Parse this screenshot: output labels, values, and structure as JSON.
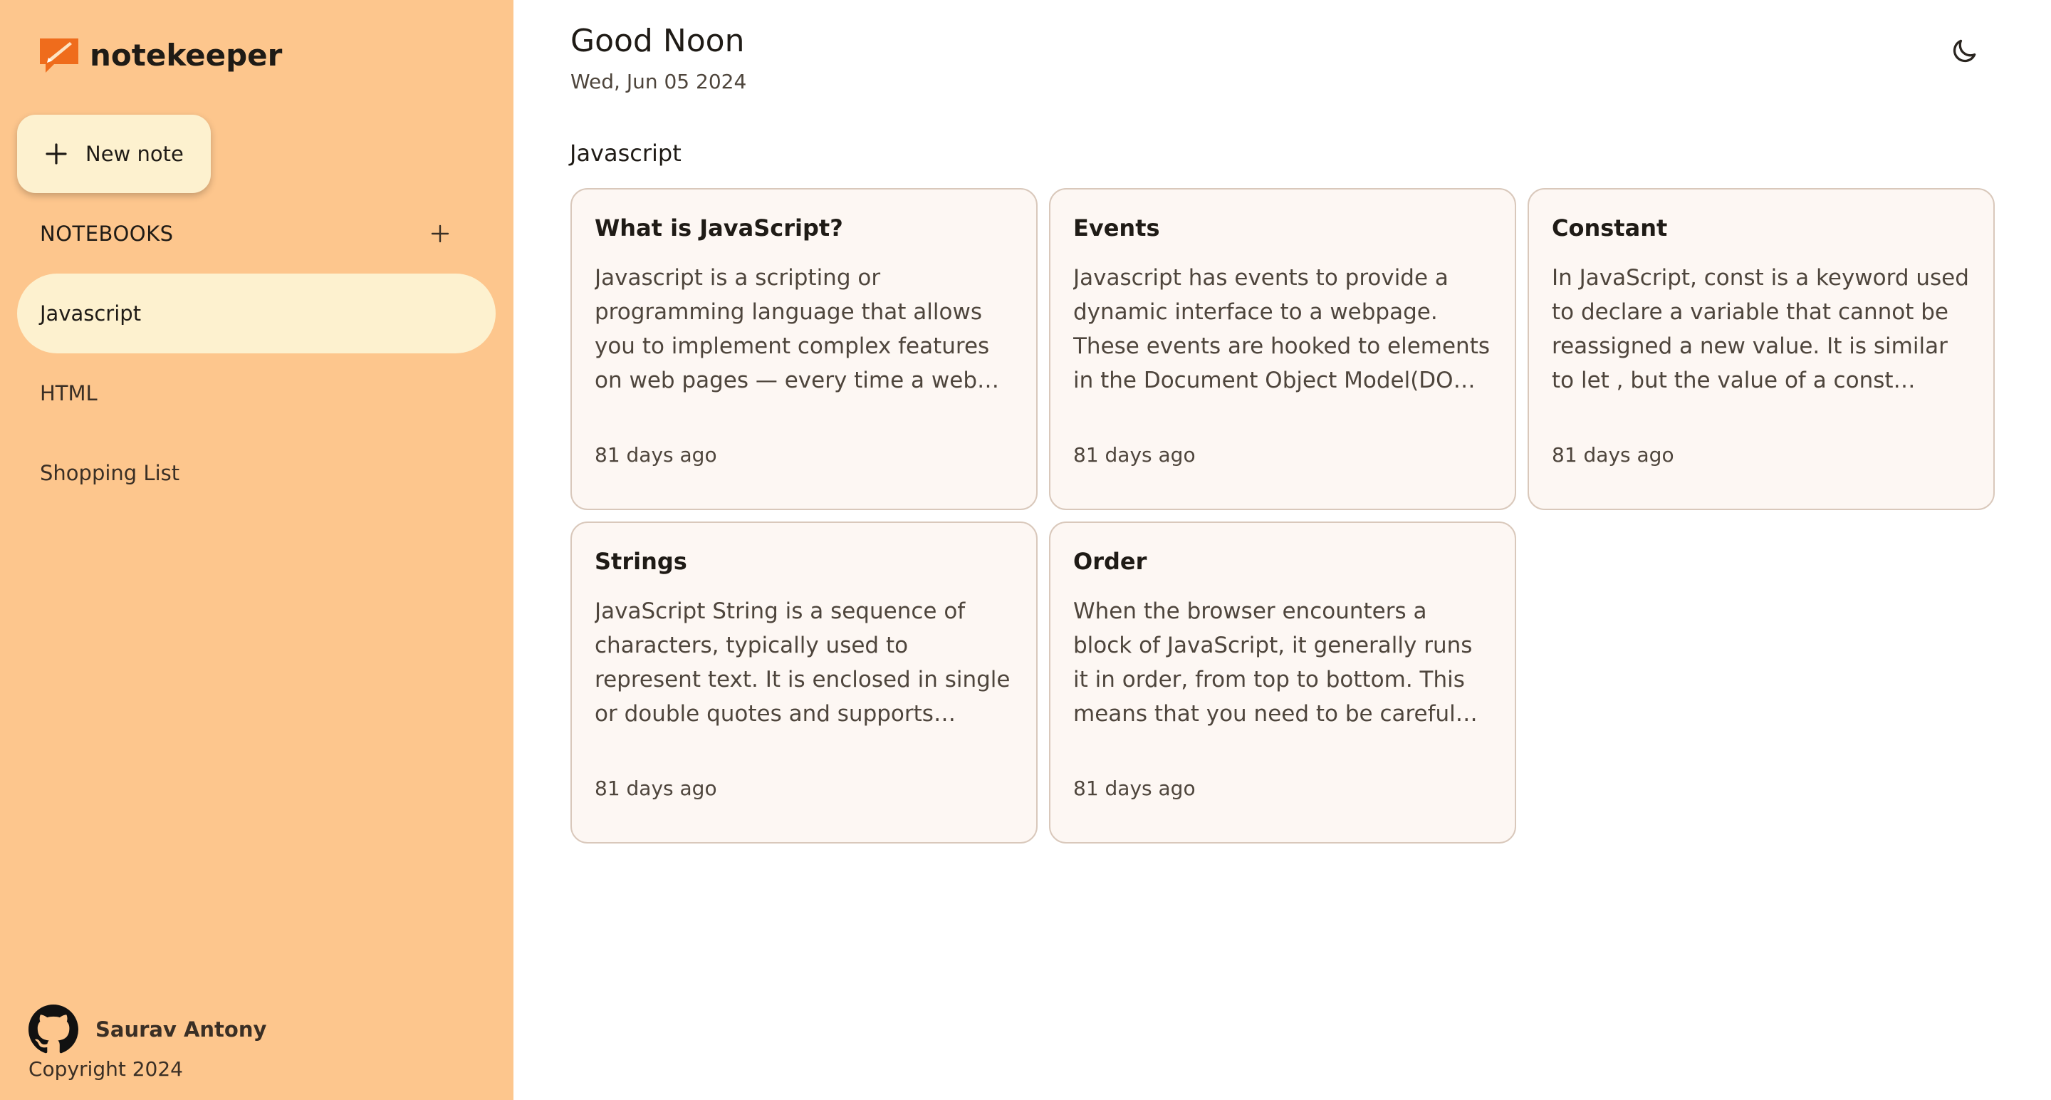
{
  "app": {
    "name": "notekeeper",
    "colors": {
      "sidebar": "#fdc68d",
      "active": "#fdf1cf",
      "accent": "#ef6c1c",
      "card": "#fdf7f3"
    }
  },
  "sidebar": {
    "new_note_label": "New note",
    "notebooks_title": "NOTEBOOKS",
    "items": [
      {
        "label": "Javascript",
        "active": true
      },
      {
        "label": "HTML",
        "active": false
      },
      {
        "label": "Shopping List",
        "active": false
      }
    ],
    "footer": {
      "author": "Saurav Antony",
      "copyright": "Copyright 2024",
      "icon": "github-icon"
    }
  },
  "header": {
    "greeting": "Good Noon",
    "date": "Wed, Jun 05 2024",
    "theme_icon": "moon-icon"
  },
  "main": {
    "notebook_title": "Javascript",
    "notes": [
      {
        "title": "What is JavaScript?",
        "text": "Javascript is a scripting or programming language that allows you to implement complex features on web pages — every time a web page does more than just sit there and display static information for you to look at.",
        "time": "81 days ago"
      },
      {
        "title": "Events",
        "text": "Javascript has events to provide a dynamic interface to a webpage. These events are hooked to elements in the Document Object Model(DOM) and can respond to user actions.",
        "time": "81 days ago"
      },
      {
        "title": "Constant",
        "text": "In JavaScript, const is a keyword used to declare a variable that cannot be reassigned a new value. It is similar to let , but the value of a const variable cannot be changed once it is assigned.",
        "time": "81 days ago"
      },
      {
        "title": "Strings",
        "text": "JavaScript String is a sequence of characters, typically used to represent text. It is enclosed in single or double quotes and supports various methods for text manipulation.",
        "time": "81 days ago"
      },
      {
        "title": "Order",
        "text": "When the browser encounters a block of JavaScript, it generally runs it in order, from top to bottom. This means that you need to be careful what order you put things in.",
        "time": "81 days ago"
      }
    ]
  }
}
